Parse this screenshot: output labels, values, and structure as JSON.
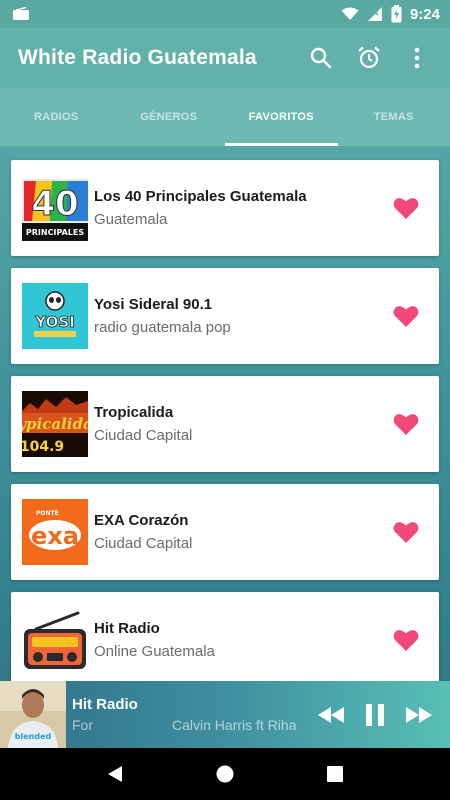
{
  "status_bar": {
    "time": "9:24"
  },
  "app_bar": {
    "title": "White Radio Guatemala",
    "actions": [
      "search-icon",
      "alarm-icon",
      "more-vert-icon"
    ]
  },
  "tabs": [
    {
      "label": "RADIOS",
      "active": false
    },
    {
      "label": "GÉNEROS",
      "active": false
    },
    {
      "label": "FAVORITOS",
      "active": true
    },
    {
      "label": "TEMAS",
      "active": false
    }
  ],
  "stations": [
    {
      "name": "Los 40 Principales Guatemala",
      "subtitle": "Guatemala",
      "logo_text": "40",
      "logo_caption": "PRINCIPALES"
    },
    {
      "name": "Yosi Sideral 90.1",
      "subtitle": "radio guatemala pop",
      "logo_text": "YOSI"
    },
    {
      "name": "Tropicalida",
      "subtitle": "Ciudad Capital",
      "logo_text": "ypicalida",
      "logo_caption": "104.9"
    },
    {
      "name": "EXA Corazón",
      "subtitle": "Ciudad Capital",
      "logo_text": "exa",
      "logo_caption": "PONTE"
    },
    {
      "name": "Hit Radio",
      "subtitle": "Online Guatemala"
    }
  ],
  "player": {
    "station": "Hit Radio",
    "track_part_1": "For",
    "track_part_2": "Calvin Harris ft Riha",
    "art_caption": "blended"
  },
  "colors": {
    "accent": "#62b1aa",
    "heart": "#f2487a",
    "nav": "#000000"
  }
}
